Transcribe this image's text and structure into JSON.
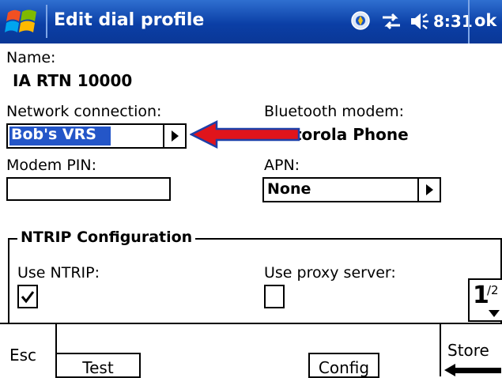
{
  "titlebar": {
    "title": "Edit dial profile",
    "time": "8:31",
    "ok_label": "ok",
    "icons": [
      "windows-logo",
      "signal-icon",
      "connectivity-icon",
      "volume-icon"
    ]
  },
  "form": {
    "name_label": "Name:",
    "name_value": "IA RTN 10000",
    "network_label": "Network connection:",
    "network_value": "Bob's VRS",
    "bluetooth_label": "Bluetooth modem:",
    "bluetooth_value": "torola Phone",
    "modem_pin_label": "Modem PIN:",
    "modem_pin_value": "",
    "apn_label": "APN:",
    "apn_value": "None"
  },
  "ntrip": {
    "group_title": "NTRIP Configuration",
    "use_ntrip_label": "Use NTRIP:",
    "use_ntrip_checked": true,
    "use_proxy_label": "Use proxy server:",
    "use_proxy_checked": false
  },
  "pager": {
    "current": "1",
    "total": "/2"
  },
  "menubar": {
    "esc_label": "Esc",
    "test_label": "Test",
    "config_label": "Config",
    "store_label": "Store"
  },
  "colors": {
    "titlebar": "#0b3fa6",
    "selection": "#2456c8",
    "annotation_arrow": "#e0141c"
  }
}
